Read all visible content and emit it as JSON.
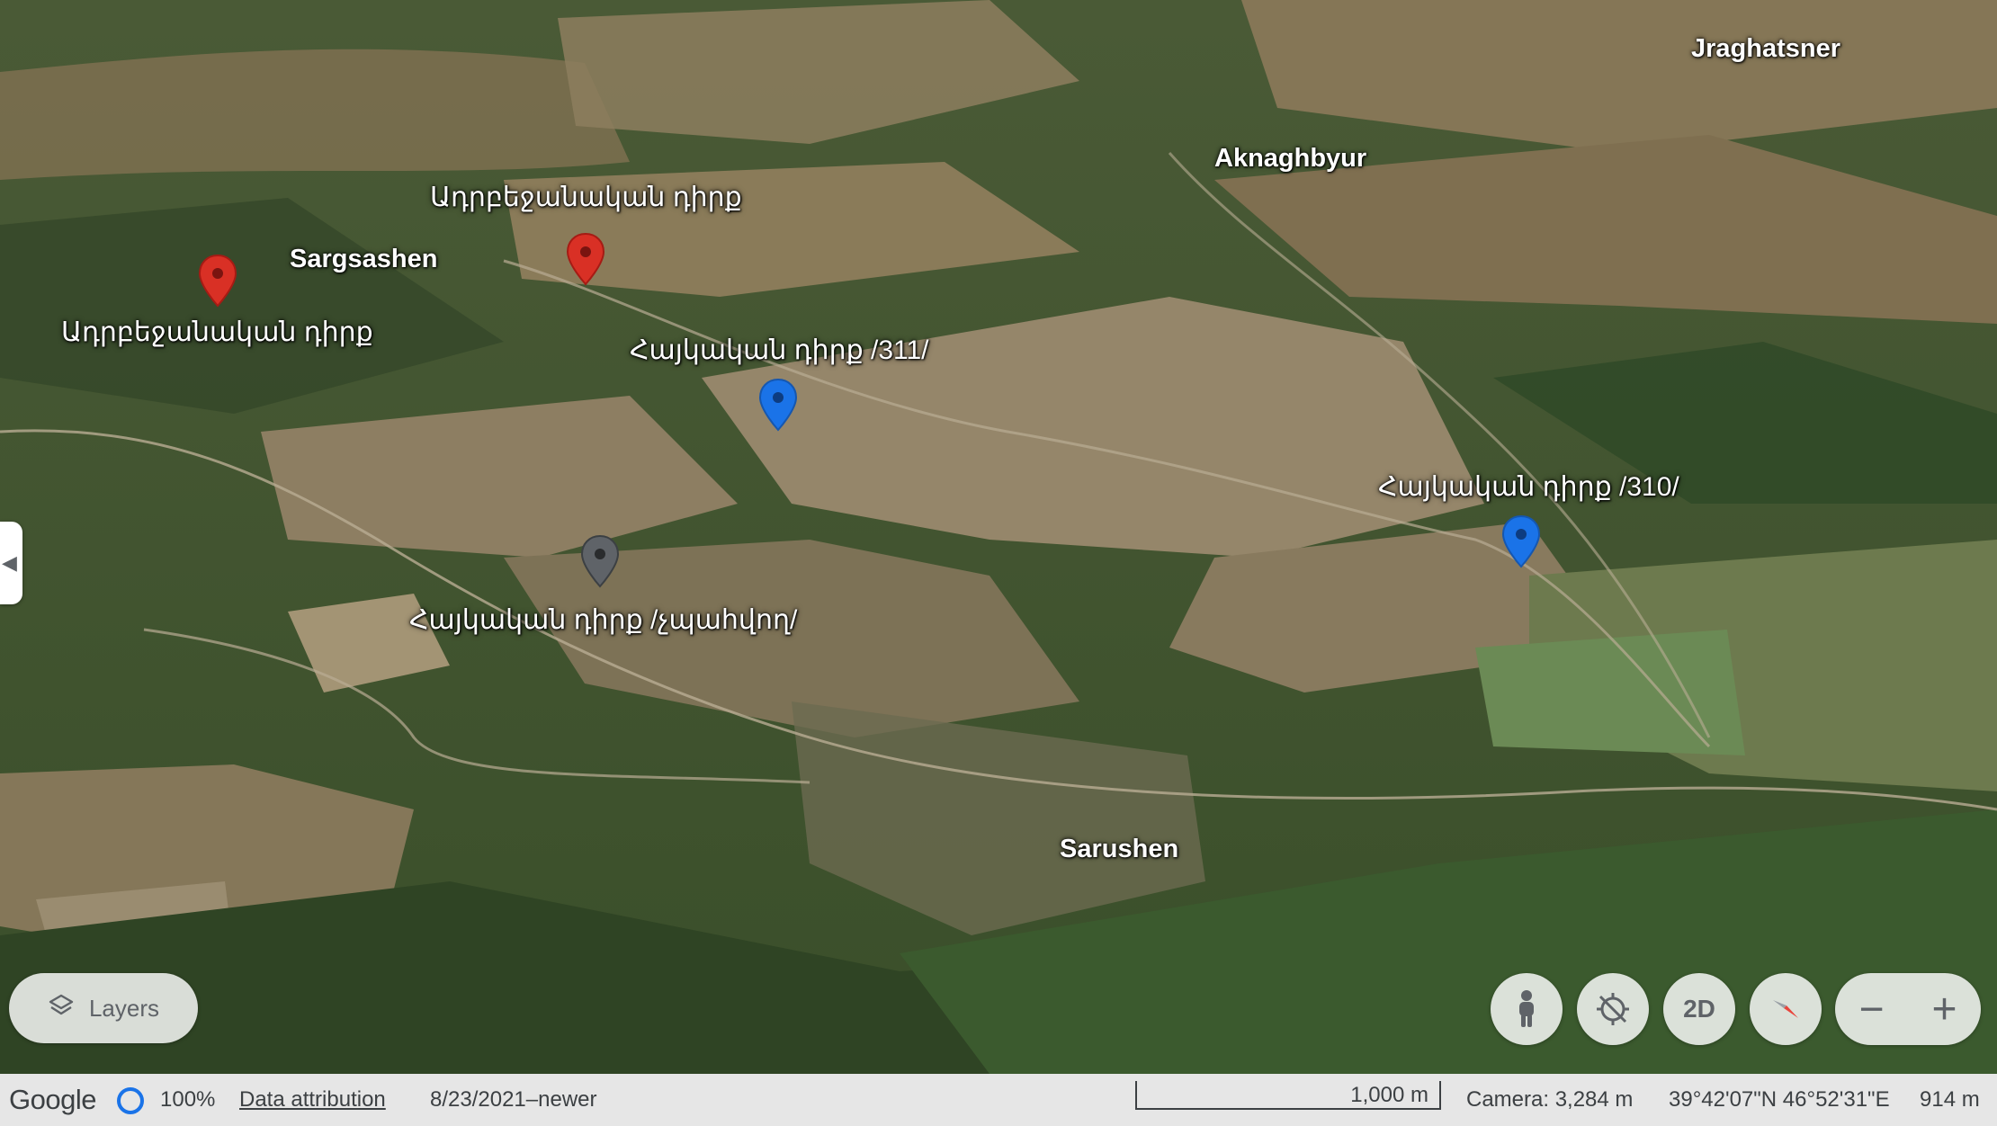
{
  "places": {
    "jraghatsner": "Jraghatsner",
    "aknaghbyur": "Aknaghbyur",
    "sargsashen": "Sargsashen",
    "sarushen": "Sarushen"
  },
  "pins": [
    {
      "label": "Ադրբեջանական դիրք",
      "color": "#d93025",
      "icon": "red-pin-icon"
    },
    {
      "label": "Ադրբեջանական դիրք",
      "color": "#d93025",
      "icon": "red-pin-icon"
    },
    {
      "label": "Հայկական դիրք /311/",
      "color": "#1a73e8",
      "icon": "blue-pin-icon"
    },
    {
      "label": "Հայկական դիրք /310/",
      "color": "#1a73e8",
      "icon": "blue-pin-icon"
    },
    {
      "label": "Հայկական դիրք /չպահվող/",
      "color": "#5f6368",
      "icon": "gray-pin-icon"
    }
  ],
  "controls": {
    "layers_label": "Layers",
    "layers_icon": "layers-icon",
    "pegman_icon": "pegman-icon",
    "gps_icon": "location-off-icon",
    "view_mode": "2D",
    "compass_icon": "compass-icon",
    "zoom_out": "−",
    "zoom_in": "+"
  },
  "status": {
    "logo": "Google",
    "loading": "100%",
    "attribution": "Data attribution",
    "imagery_date": "8/23/2021–newer",
    "scale": "1,000 m",
    "camera": "Camera: 3,284 m",
    "coordinates": "39°42'07\"N 46°52'31\"E",
    "elevation": "914 m"
  },
  "colors": {
    "forest": "#2e4a22",
    "field": "#8a7a5c",
    "status_bg": "#e6e6e6",
    "accent": "#1a73e8"
  }
}
